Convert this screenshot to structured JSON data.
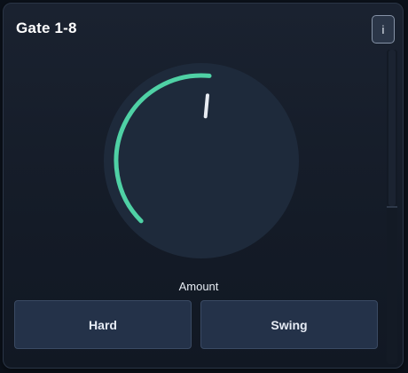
{
  "header": {
    "title": "Gate 1-8",
    "info_label": "i"
  },
  "knob": {
    "label": "Amount",
    "value": 0.52,
    "colors": {
      "body": "#1e2a3b",
      "arc": "#4fd1a5",
      "pointer": "#e8ecf2"
    }
  },
  "buttons": {
    "hard_label": "Hard",
    "swing_label": "Swing"
  }
}
